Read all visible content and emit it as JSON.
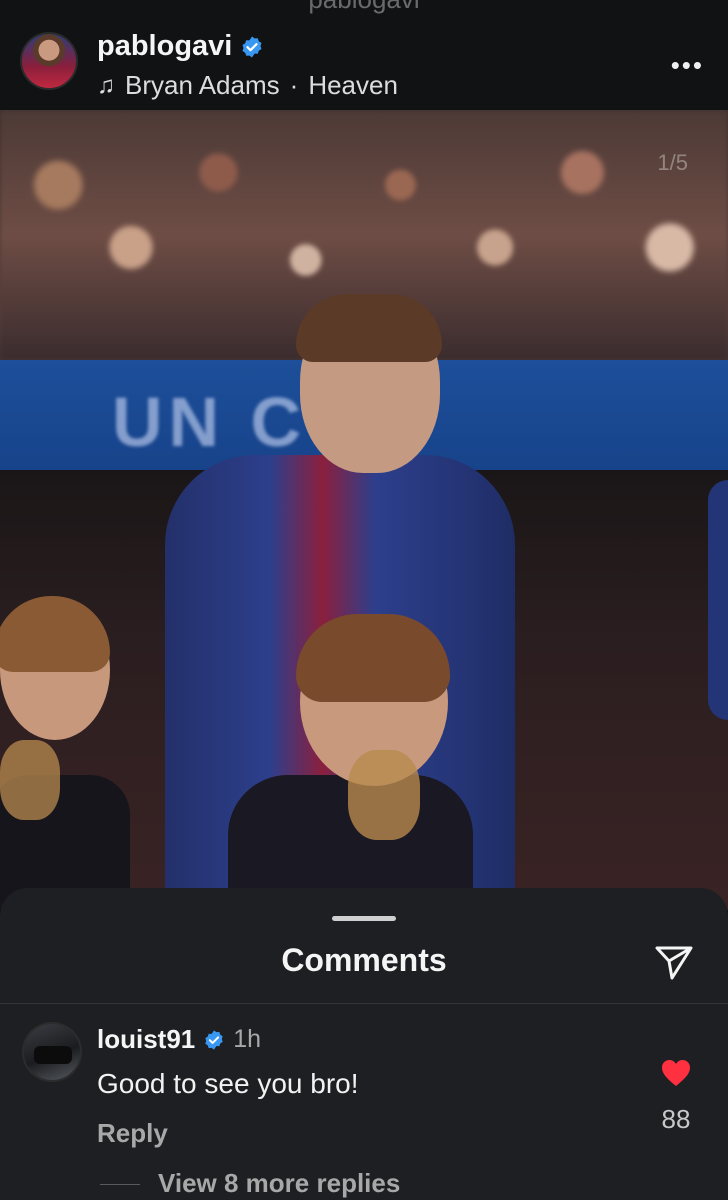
{
  "header": {
    "top_strip_text": "pablogavi",
    "username": "pablogavi",
    "music_artist": "Bryan Adams",
    "music_separator": "·",
    "music_song": "Heaven",
    "more_label": "•••"
  },
  "photo": {
    "counter": "1/5",
    "banner_text": "UN C  T"
  },
  "comments": {
    "title": "Comments",
    "items": [
      {
        "user": "louist91",
        "time": "1h",
        "text": "Good to see you bro!",
        "reply_label": "Reply",
        "likes": "88",
        "liked": true,
        "view_more": "View 8 more replies"
      }
    ]
  },
  "colors": {
    "verified_blue": "#3897f0",
    "heart_red": "#ff3040",
    "sheet_bg": "#1e1f22"
  },
  "icons": {
    "music": "music-note-icon",
    "verified": "verified-badge-icon",
    "share": "paper-plane-icon",
    "like": "heart-filled-icon",
    "more": "more-dots-icon"
  }
}
